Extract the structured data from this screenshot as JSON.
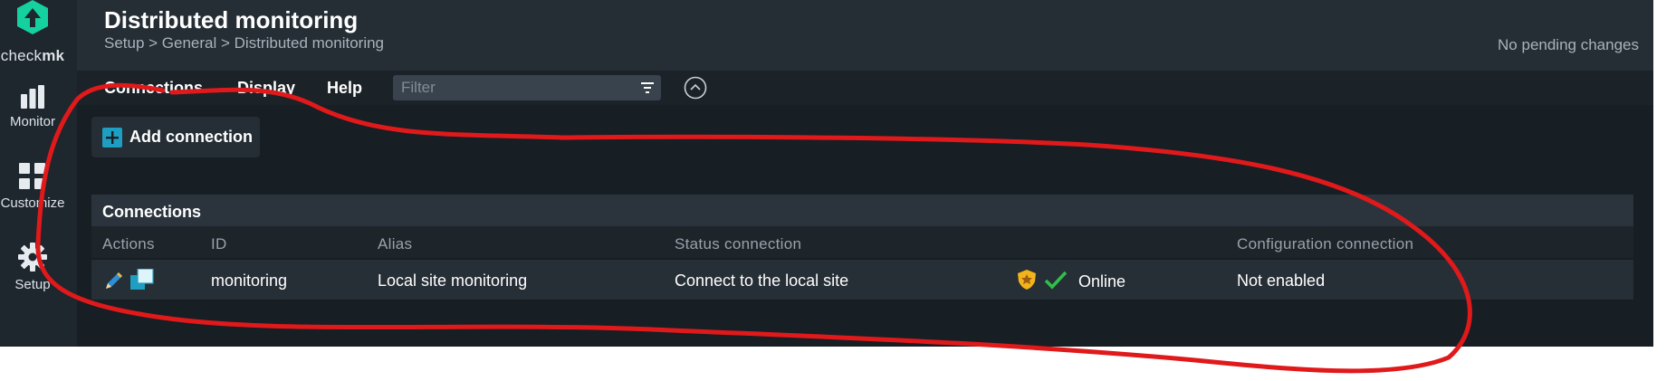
{
  "app": {
    "logo_text_light": "check",
    "logo_text_bold": "mk",
    "brand_color": "#15d1a0"
  },
  "sidebar": {
    "items": [
      {
        "label": "Monitor",
        "icon": "bar-chart-icon"
      },
      {
        "label": "Customize",
        "icon": "grid-icon"
      },
      {
        "label": "Setup",
        "icon": "gear-icon"
      }
    ]
  },
  "header": {
    "title": "Distributed monitoring",
    "breadcrumb": "Setup > General > Distributed monitoring",
    "pending": "No pending changes"
  },
  "menubar": {
    "items": [
      "Connections",
      "Display",
      "Help"
    ],
    "filter_placeholder": "Filter",
    "filter_icon": "filter-icon",
    "collapse_icon": "chevron-up-circle-icon"
  },
  "actions": {
    "add_connection_label": "Add connection"
  },
  "table": {
    "title": "Connections",
    "columns": [
      "Actions",
      "ID",
      "Alias",
      "Status connection",
      "",
      "Configuration connection"
    ],
    "rows": [
      {
        "id": "monitoring",
        "alias": "Local site monitoring",
        "status_connection": "Connect to the local site",
        "status": "Online",
        "configuration_connection": "Not enabled",
        "action_icons": [
          "edit-pencil-icon",
          "clone-icon"
        ],
        "status_icons": [
          "shield-icon",
          "checkmark-icon"
        ]
      }
    ]
  },
  "colors": {
    "accent": "#1e9ec0",
    "online": "#2fbf4a",
    "annotation": "#e0191b"
  }
}
